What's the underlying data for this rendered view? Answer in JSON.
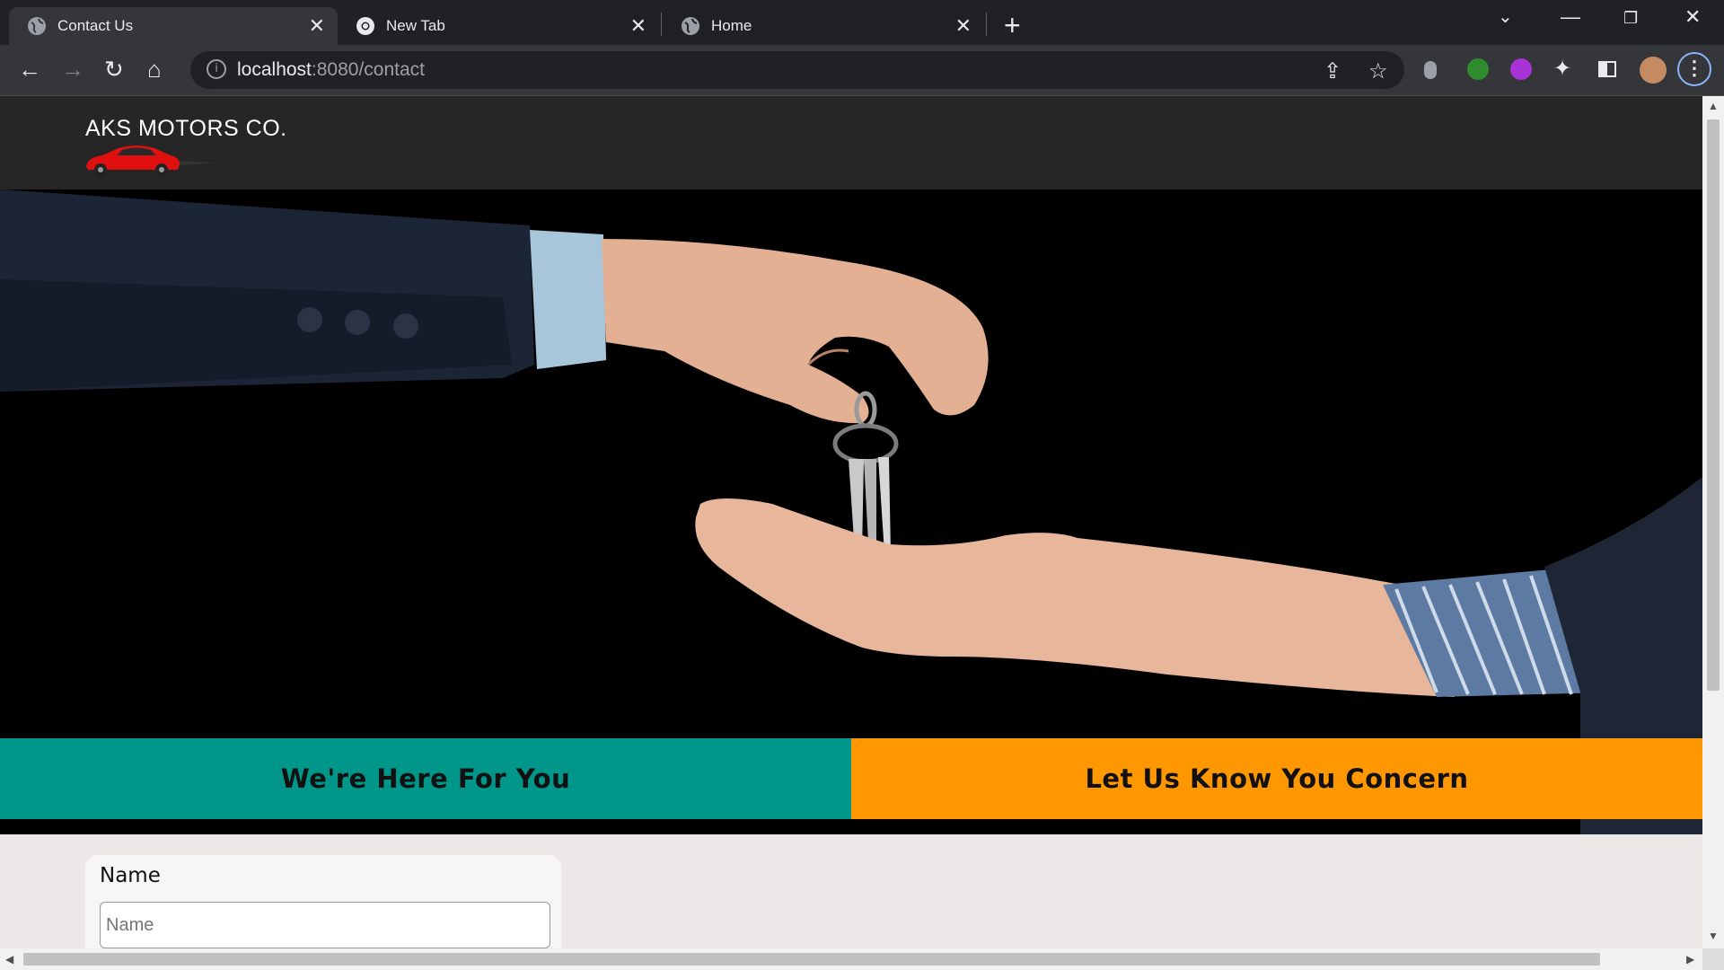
{
  "browser": {
    "tabs": [
      {
        "label": "Contact Us",
        "active": true,
        "favicon": "globe-icon"
      },
      {
        "label": "New Tab",
        "active": false,
        "favicon": "chrome-icon"
      },
      {
        "label": "Home",
        "active": false,
        "favicon": "globe-icon"
      }
    ],
    "url_host": "localhost",
    "url_rest": ":8080/contact"
  },
  "site": {
    "brand": "AKS MOTORS CO.",
    "hero_image": "hand passing car keys to open palm"
  },
  "bands": {
    "left": "We're Here For You",
    "right": "Let Us Know You Concern"
  },
  "form": {
    "name_label": "Name",
    "name_placeholder": "Name",
    "name_value": ""
  },
  "colors": {
    "teal": "#00968a",
    "orange": "#ff9800",
    "header": "#262626"
  }
}
